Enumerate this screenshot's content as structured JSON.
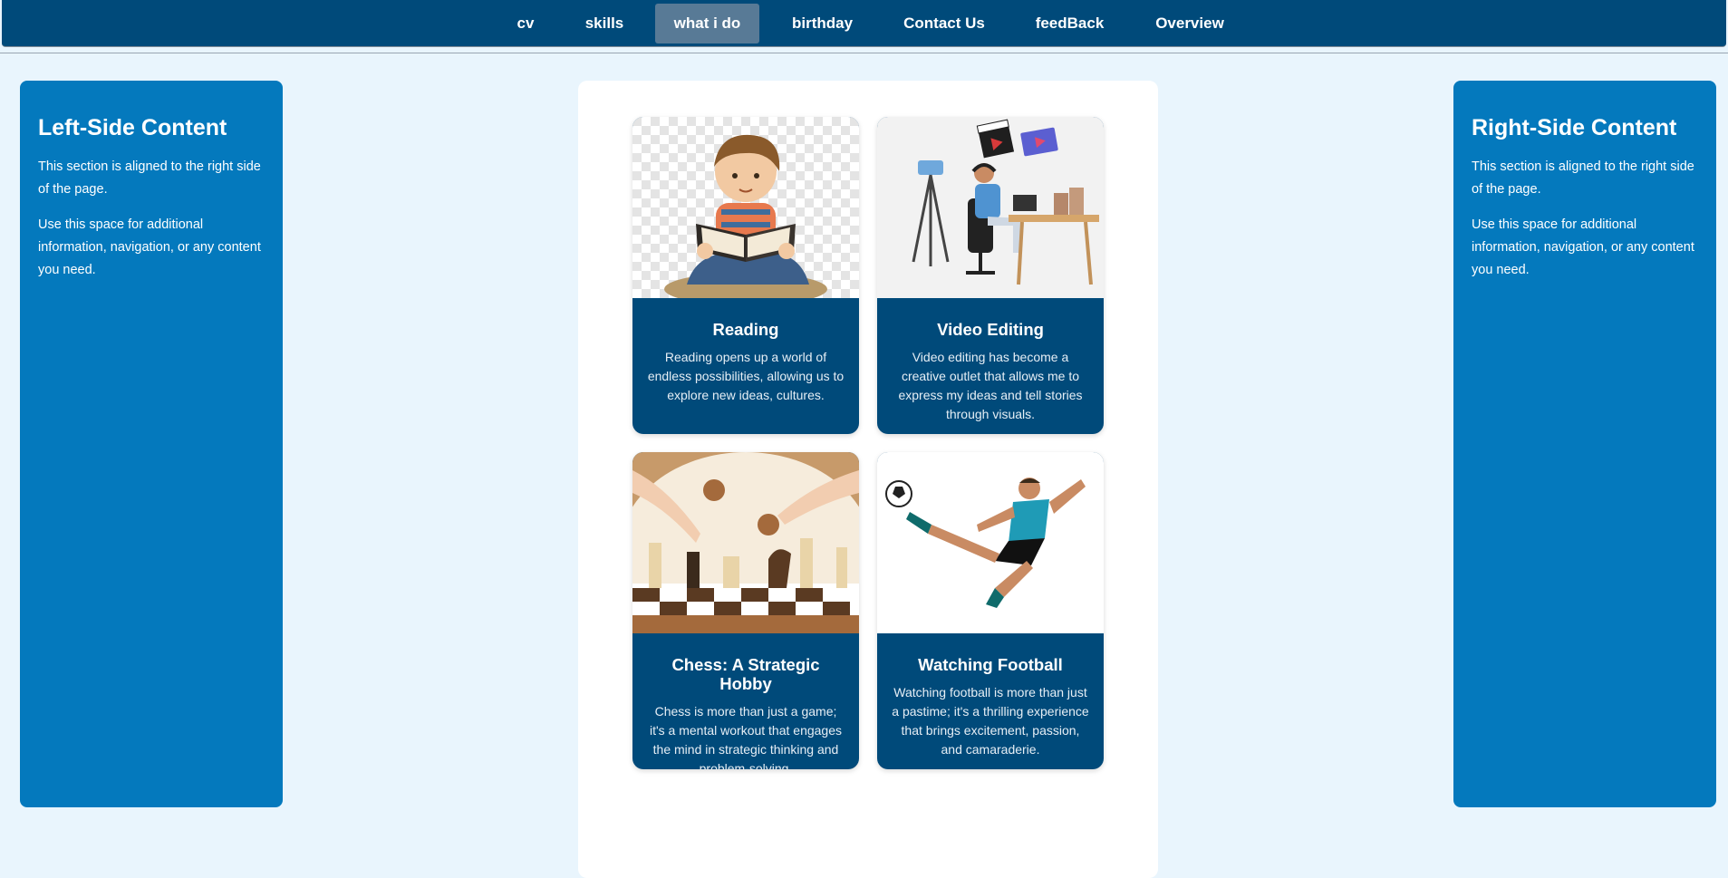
{
  "nav": {
    "items": [
      {
        "label": "cv"
      },
      {
        "label": "skills"
      },
      {
        "label": "what i do",
        "active": true
      },
      {
        "label": "birthday"
      },
      {
        "label": "Contact Us"
      },
      {
        "label": "feedBack"
      },
      {
        "label": "Overview"
      }
    ]
  },
  "left": {
    "title": "Left-Side Content",
    "p1": "This section is aligned to the right side of the page.",
    "p2": "Use this space for additional information, navigation, or any content you need."
  },
  "right": {
    "title": "Right-Side Content",
    "p1": "This section is aligned to the right side of the page.",
    "p2": "Use this space for additional information, navigation, or any content you need."
  },
  "cards": [
    {
      "title": "Reading",
      "text": "Reading opens up a world of endless possibilities, allowing us to explore new ideas, cultures."
    },
    {
      "title": "Video Editing",
      "text": "Video editing has become a creative outlet that allows me to express my ideas and tell stories through visuals."
    },
    {
      "title": "Chess: A Strategic Hobby",
      "text": "Chess is more than just a game; it's a mental workout that engages the mind in strategic thinking and problem-solving."
    },
    {
      "title": "Watching Football",
      "text": "Watching football is more than just a pastime; it's a thrilling experience that brings excitement, passion, and camaraderie."
    }
  ],
  "colors": {
    "nav_bg": "#004a7a",
    "side_bg": "#0479bd",
    "card_body": "#004a7a",
    "page_bg": "#e9f5fd"
  }
}
